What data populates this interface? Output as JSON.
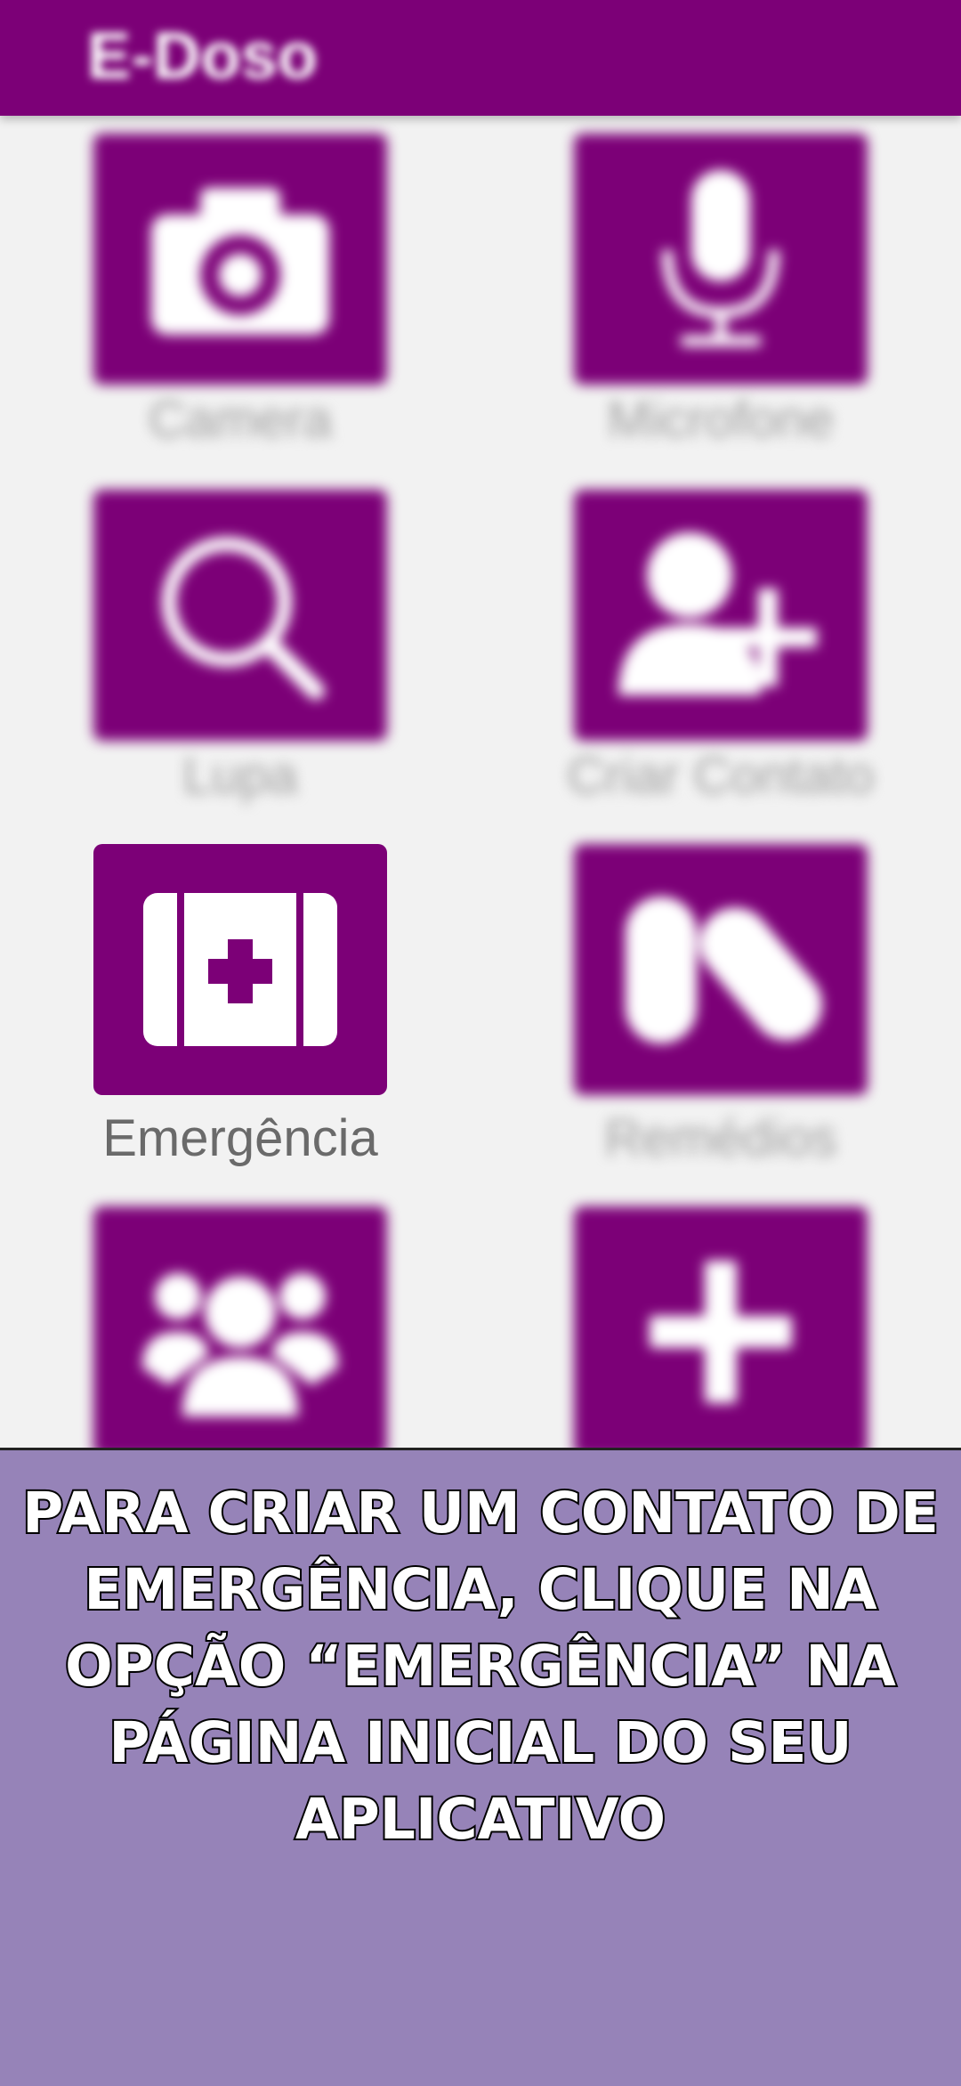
{
  "app": {
    "title": "E-Doso",
    "accent": "#7c0077"
  },
  "tiles": [
    {
      "label": "Camera",
      "icon": "camera-icon"
    },
    {
      "label": "Microfone",
      "icon": "microphone-icon"
    },
    {
      "label": "Lupa",
      "icon": "magnifier-icon"
    },
    {
      "label": "Criar Contato",
      "icon": "add-contact-icon"
    },
    {
      "label": "Emergência",
      "icon": "first-aid-kit-icon"
    },
    {
      "label": "Remédios",
      "icon": "pills-icon"
    },
    {
      "label": "",
      "icon": "group-icon"
    },
    {
      "label": "",
      "icon": "plus-icon"
    }
  ],
  "instruction": {
    "text": "PARA CRIAR UM CONTATO DE EMERGÊNCIA, CLIQUE NA OPÇÃO “EMERGÊNCIA” NA PÁGINA INICIAL DO SEU APLICATIVO",
    "background": "#9683b8"
  }
}
